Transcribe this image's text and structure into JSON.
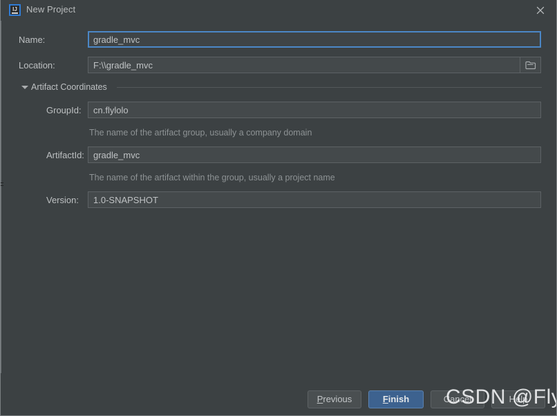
{
  "window": {
    "title": "New Project",
    "app_icon": "intellij-idea-icon",
    "close_icon": "close-icon",
    "background_color": "#3c4143",
    "border_color": "#7a7f82"
  },
  "form": {
    "name": {
      "label": "Name:",
      "value": "gradle_mvc",
      "placeholder": "",
      "focused": true,
      "focus_border_color": "#4b87c7"
    },
    "location": {
      "label": "Location:",
      "value": "F:\\\\gradle_mvc",
      "placeholder": "",
      "browse_icon": "folder-icon"
    }
  },
  "artifact_coordinates": {
    "title": "Artifact Coordinates",
    "expanded": true,
    "collapse_icon": "chevron-down-icon",
    "fields": [
      {
        "id": "groupid",
        "label": "GroupId:",
        "value": "cn.flylolo",
        "helper": "The name of the artifact group, usually a company domain"
      },
      {
        "id": "artifactid",
        "label": "ArtifactId:",
        "value": "gradle_mvc",
        "helper": "The name of the artifact within the group, usually a project name"
      },
      {
        "id": "version",
        "label": "Version:",
        "value": "1.0-SNAPSHOT",
        "helper": ""
      }
    ]
  },
  "footer": {
    "buttons": [
      {
        "id": "previous",
        "label": "Previous",
        "mnemonic": "P",
        "primary": false
      },
      {
        "id": "finish",
        "label": "Finish",
        "mnemonic": "F",
        "primary": true
      },
      {
        "id": "cancel",
        "label": "Cancel",
        "mnemonic": "",
        "primary": false
      },
      {
        "id": "help",
        "label": "Help",
        "mnemonic": "",
        "primary": false
      }
    ],
    "primary_color": "#3d628f"
  },
  "watermark": {
    "text": "CSDN @FlyLolo"
  }
}
